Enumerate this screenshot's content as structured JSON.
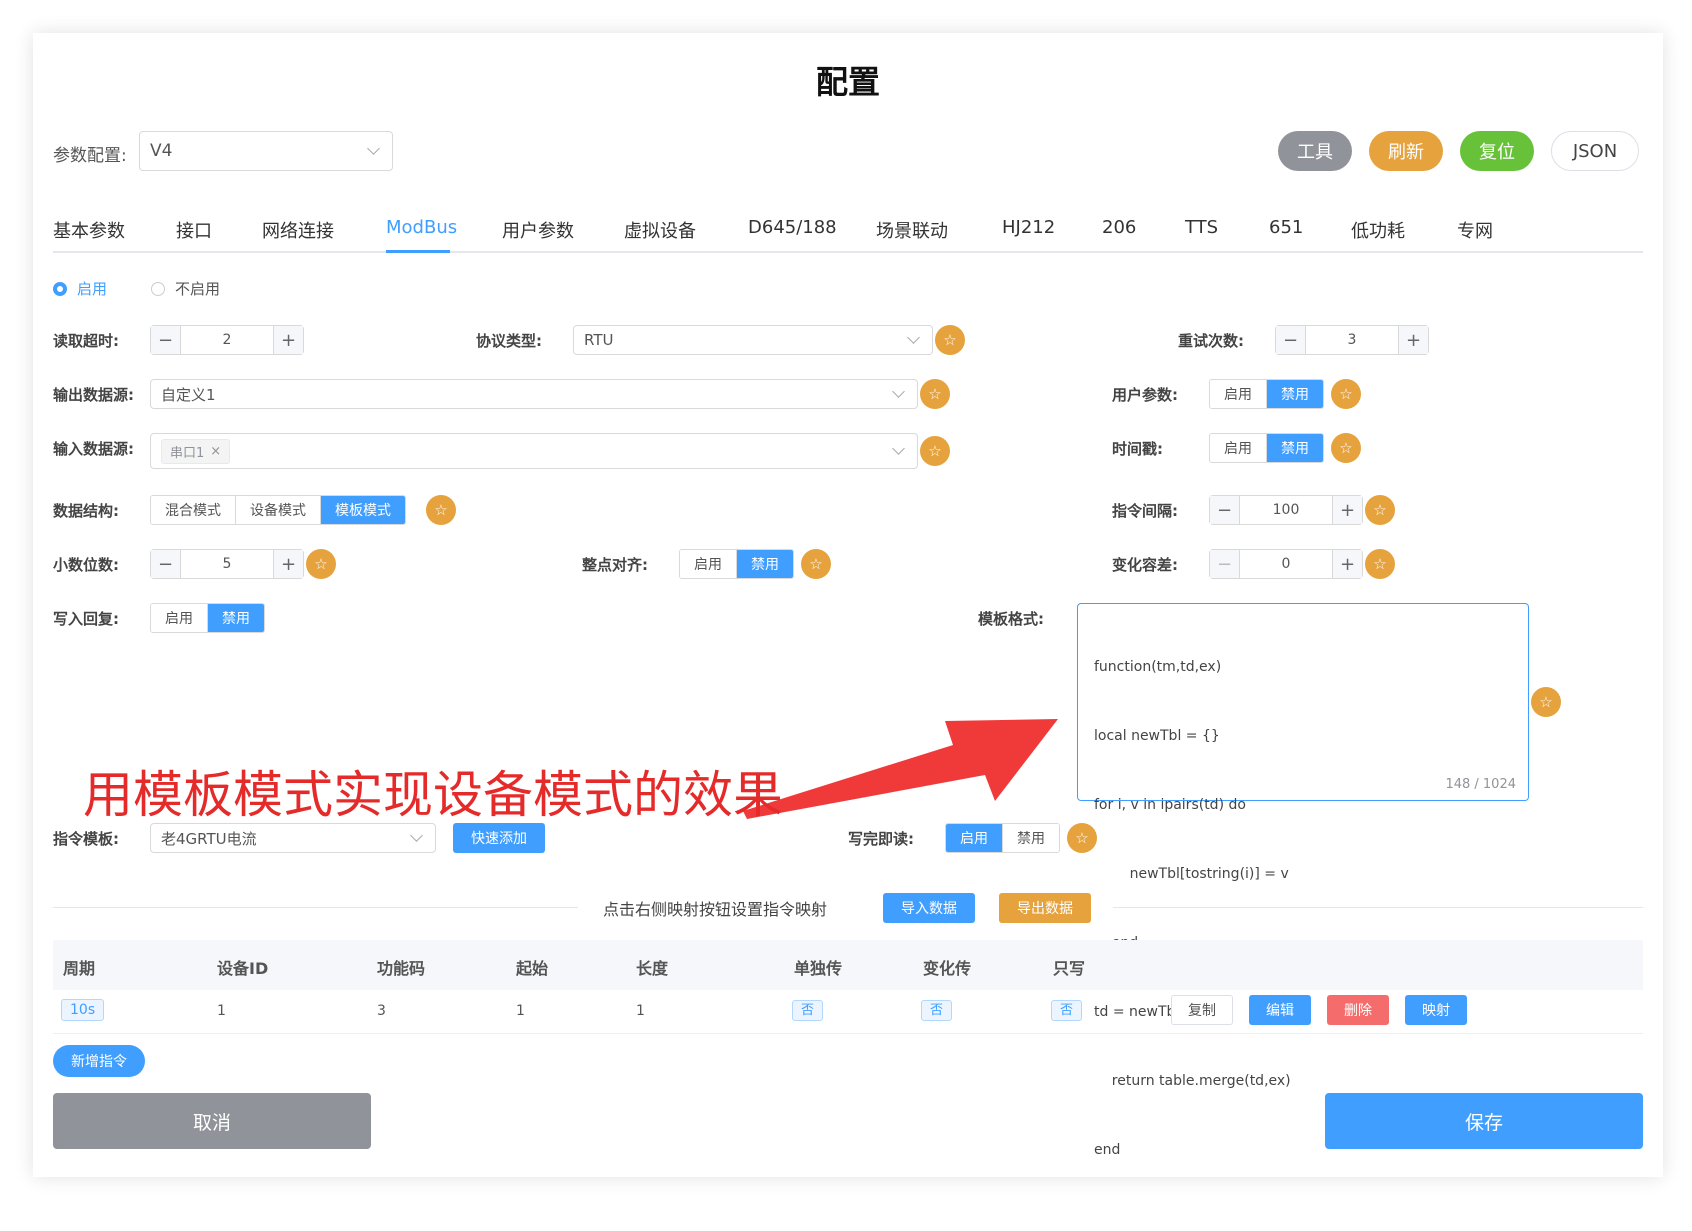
{
  "title": "配置",
  "param_config": {
    "label": "参数配置:",
    "value": "V4"
  },
  "top_buttons": {
    "tools": "工具",
    "refresh": "刷新",
    "reset": "复位",
    "json": "JSON"
  },
  "tabs": [
    "基本参数",
    "接口",
    "网络连接",
    "ModBus",
    "用户参数",
    "虚拟设备",
    "D645/188",
    "场景联动",
    "HJ212",
    "206",
    "TTS",
    "651",
    "低功耗",
    "专网"
  ],
  "active_tab": "ModBus",
  "enable_radio": {
    "on": "启用",
    "off": "不启用"
  },
  "read_timeout": {
    "label": "读取超时:",
    "value": "2"
  },
  "protocol_type": {
    "label": "协议类型:",
    "value": "RTU"
  },
  "retry_count": {
    "label": "重试次数:",
    "value": "3"
  },
  "output_source": {
    "label": "输出数据源:",
    "value": "自定义1"
  },
  "user_params": {
    "label": "用户参数:",
    "on": "启用",
    "off": "禁用"
  },
  "input_source": {
    "label": "输入数据源:",
    "tag": "串口1"
  },
  "timestamp": {
    "label": "时间戳:",
    "on": "启用",
    "off": "禁用"
  },
  "data_structure": {
    "label": "数据结构:",
    "options": [
      "混合模式",
      "设备模式",
      "模板模式"
    ],
    "selected": "模板模式"
  },
  "cmd_interval": {
    "label": "指令间隔:",
    "value": "100"
  },
  "decimals": {
    "label": "小数位数:",
    "value": "5"
  },
  "hour_align": {
    "label": "整点对齐:",
    "on": "启用",
    "off": "禁用"
  },
  "change_tolerance": {
    "label": "变化容差:",
    "value": "0"
  },
  "write_reply": {
    "label": "写入回复:",
    "on": "启用",
    "off": "禁用"
  },
  "template_format": {
    "label": "模板格式:",
    "lines": [
      "function(tm,td,ex)",
      "local newTbl = {}",
      "for i, v in ipairs(td) do",
      "        newTbl[tostring(i)] = v",
      "    end",
      "td = newTbl",
      "    return table.merge(td,ex)",
      "end"
    ],
    "counter": "148 / 1024"
  },
  "annotation": "用模板模式实现设备模式的效果",
  "cmd_template": {
    "label": "指令模板:",
    "value": "老4GRTU电流",
    "quick_add": "快速添加"
  },
  "write_then_read": {
    "label": "写完即读:",
    "on": "启用",
    "off": "禁用"
  },
  "mapping": {
    "hint": "点击右侧映射按钮设置指令映射",
    "import": "导入数据",
    "export": "导出数据"
  },
  "table": {
    "headers": [
      "周期",
      "设备ID",
      "功能码",
      "起始",
      "长度",
      "单独传",
      "变化传",
      "只写"
    ],
    "rows": [
      {
        "period": "10s",
        "device_id": "1",
        "func_code": "3",
        "start": "1",
        "length": "1",
        "single": "否",
        "change": "否",
        "write_only": "否"
      }
    ],
    "actions": {
      "copy": "复制",
      "edit": "编辑",
      "delete": "删除",
      "map": "映射"
    }
  },
  "add_cmd": "新增指令",
  "footer": {
    "cancel": "取消",
    "save": "保存"
  },
  "colors": {
    "primary": "#409eff",
    "warning": "#e6a23c",
    "success": "#67c23a",
    "danger": "#f56c6c",
    "info": "#909399",
    "annotation": "#e52a2a"
  }
}
